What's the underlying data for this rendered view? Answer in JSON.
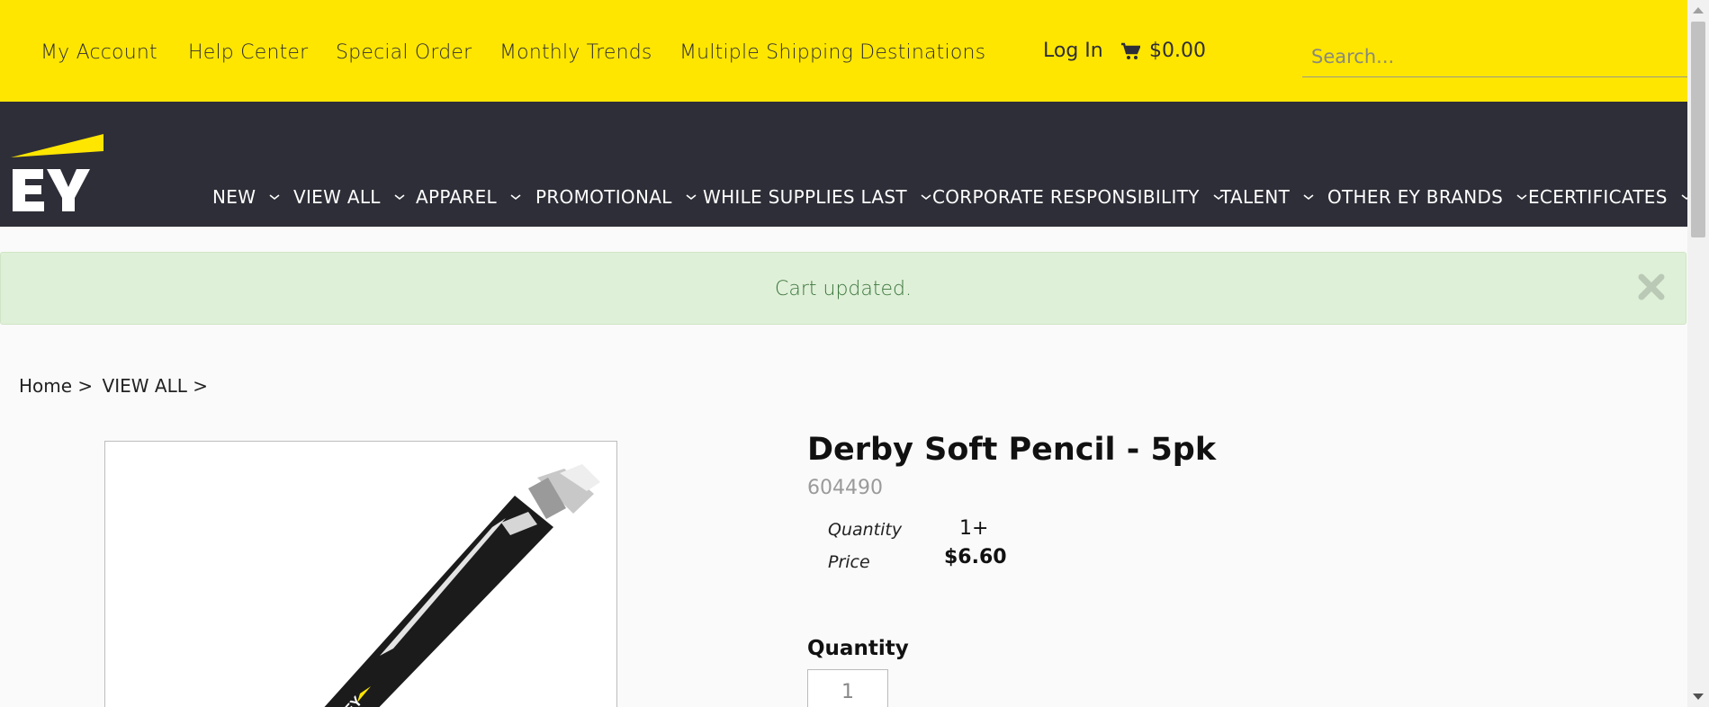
{
  "topbar": {
    "links": [
      "My Account",
      "Help Center",
      "Special Order",
      "Monthly Trends",
      "Multiple Shipping Destinations"
    ],
    "login": "Log In",
    "cart_total": "$0.00",
    "search_placeholder": "Search..."
  },
  "nav": {
    "items": [
      "NEW",
      "VIEW ALL",
      "APPAREL",
      "PROMOTIONAL",
      "WHILE SUPPLIES LAST",
      "CORPORATE RESPONSIBILITY",
      "TALENT",
      "OTHER EY BRANDS",
      "ECERTIFICATES"
    ]
  },
  "alert": {
    "message": "Cart updated."
  },
  "breadcrumb": {
    "home": "Home",
    "sep1": ">",
    "section": "VIEW ALL",
    "sep2": ">"
  },
  "product": {
    "title": "Derby Soft Pencil - 5pk",
    "sku": "604490",
    "pricing": {
      "quantity_label": "Quantity",
      "quantity_value": "1+",
      "price_label": "Price",
      "price_value": "$6.60"
    },
    "quantity_heading": "Quantity",
    "quantity_input": "1"
  },
  "colors": {
    "yellow": "#ffe600",
    "dark": "#2e2e38",
    "alert_bg": "#dff0d8",
    "alert_text": "#3c763d"
  }
}
